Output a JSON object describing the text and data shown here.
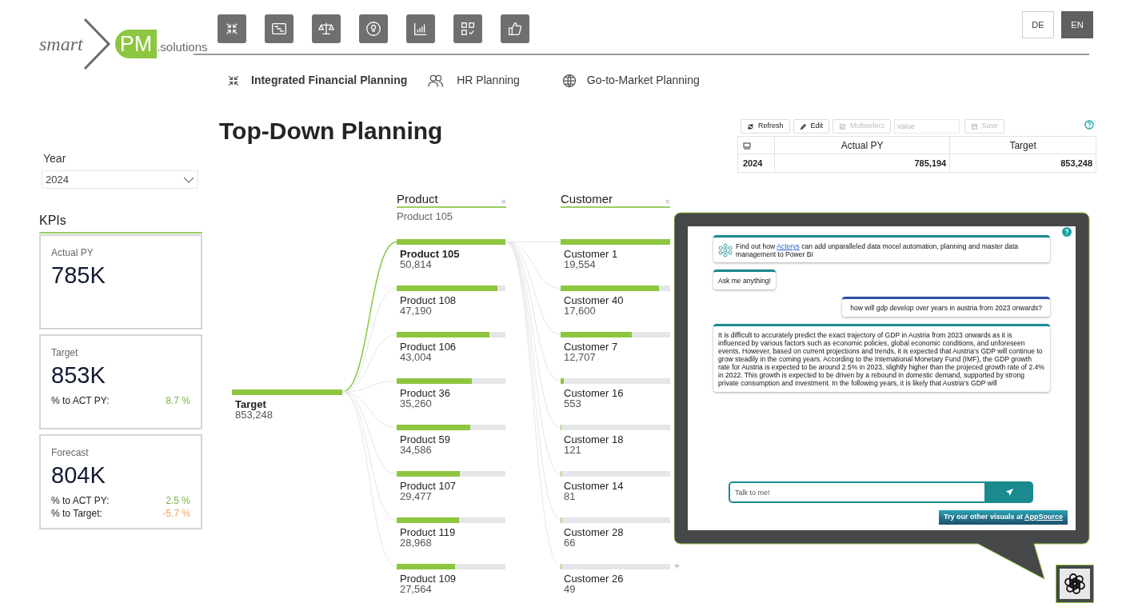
{
  "logo": {
    "word": "smart",
    "badge": "PM",
    "suffix": ".solutions"
  },
  "languages": [
    {
      "label": "DE",
      "selected": false
    },
    {
      "label": "EN",
      "selected": true
    }
  ],
  "nav_tabs": [
    {
      "label": "Integrated Financial Planning",
      "selected": true
    },
    {
      "label": "HR Planning",
      "selected": false
    },
    {
      "label": "Go-to-Market Planning",
      "selected": false
    }
  ],
  "page_title": "Top-Down Planning",
  "filter": {
    "label": "Year",
    "value": "2024"
  },
  "kpis": {
    "heading": "KPIs",
    "cards": [
      {
        "title": "Actual PY",
        "value": "785K"
      },
      {
        "title": "Target",
        "value": "853K",
        "rows": [
          {
            "label": "% to ACT PY:",
            "value": "8.7 %",
            "color": "#7cb342"
          }
        ]
      },
      {
        "title": "Forecast",
        "value": "804K",
        "rows": [
          {
            "label": "% to ACT PY:",
            "value": "2.5 %",
            "color": "#7cb342"
          },
          {
            "label": "% to Target:",
            "value": "-5.7 %",
            "color": "#f4a259"
          }
        ]
      }
    ]
  },
  "grid": {
    "toolbar": [
      {
        "kind": "button",
        "label": "Refresh",
        "disabled": false
      },
      {
        "kind": "button",
        "label": "Edit",
        "disabled": false
      },
      {
        "kind": "button",
        "label": "Multiselect",
        "disabled": true
      },
      {
        "kind": "field",
        "placeholder": "Value"
      },
      {
        "kind": "button",
        "label": "Save",
        "disabled": true
      }
    ],
    "columns": [
      "Actual PY",
      "Target"
    ],
    "rows": [
      {
        "label": "2024",
        "cells": [
          "785,194",
          "853,248"
        ]
      }
    ]
  },
  "tree": {
    "root": {
      "label": "Target",
      "value": "853,248",
      "level": 1,
      "selected": true
    },
    "levels": [
      {
        "title": "Product",
        "close": "×",
        "filter": "Product 105",
        "nodes": [
          {
            "label": "Product 105",
            "value": "50,814",
            "level": 1,
            "selected": true
          },
          {
            "label": "Product 108",
            "value": "47,190",
            "level": 0.93,
            "selected": false
          },
          {
            "label": "Product 106",
            "value": "43,004",
            "level": 0.85,
            "selected": false
          },
          {
            "label": "Product 36",
            "value": "35,260",
            "level": 0.69,
            "selected": false
          },
          {
            "label": "Product 59",
            "value": "34,586",
            "level": 0.68,
            "selected": false
          },
          {
            "label": "Product 107",
            "value": "29,477",
            "level": 0.58,
            "selected": false
          },
          {
            "label": "Product 119",
            "value": "28,968",
            "level": 0.57,
            "selected": false
          },
          {
            "label": "Product 109",
            "value": "27,564",
            "level": 0.54,
            "selected": false
          }
        ]
      },
      {
        "title": "Customer",
        "close": "×",
        "expand": "+",
        "nodes": [
          {
            "label": "Customer 1",
            "value": "19,554",
            "level": 1,
            "selected": false
          },
          {
            "label": "Customer 40",
            "value": "17,600",
            "level": 0.9,
            "selected": false
          },
          {
            "label": "Customer 7",
            "value": "12,707",
            "level": 0.65,
            "selected": false
          },
          {
            "label": "Customer 16",
            "value": "553",
            "level": 0.03,
            "selected": false
          },
          {
            "label": "Customer 18",
            "value": "121",
            "level": 0.01,
            "selected": false
          },
          {
            "label": "Customer 14",
            "value": "81",
            "level": 0.005,
            "selected": false
          },
          {
            "label": "Customer 28",
            "value": "66",
            "level": 0.004,
            "selected": false
          },
          {
            "label": "Customer 26",
            "value": "49",
            "level": 0.003,
            "selected": false
          }
        ]
      }
    ]
  },
  "chat": {
    "messages": [
      {
        "kind": "promo",
        "parts": [
          {
            "text": "Find out how "
          },
          {
            "link": "Acterys"
          },
          {
            "text": " can add unparalleled data mocel automation, planning and master data management to Power BI"
          }
        ]
      },
      {
        "kind": "bot",
        "parts": [
          {
            "text": "Ask me anything!"
          }
        ]
      },
      {
        "kind": "user",
        "parts": [
          {
            "text": "how will gdp develop over years in austria from 2023 onwards?"
          }
        ]
      },
      {
        "kind": "bot",
        "parts": [
          {
            "text": "It is difficult to accurately predict the exact trajectory of GDP in Austria from 2023 onwards as it is influenced by various factors such as economic policies, global economic conditions, and unforeseen events. However, based on current projections and trends, it is expected that Austria's GDP will continue to grow steadily in the coming years. According to the International Monetary Fund (IMF), the GDP growth rate for Austria is expected to be around 2.5% in 2023, slightly higher than the projeced growth rate of 2.4% in 2022. This growth is expected to be driven by a rebound in domestic demand, supported by strong private consumption and investment. In the following years, it is likely that Austria's GDP will"
          }
        ]
      }
    ],
    "input_placeholder": "Talk to me!",
    "banner": {
      "text": "Try our other visuals at ",
      "link": "AppSource"
    }
  }
}
